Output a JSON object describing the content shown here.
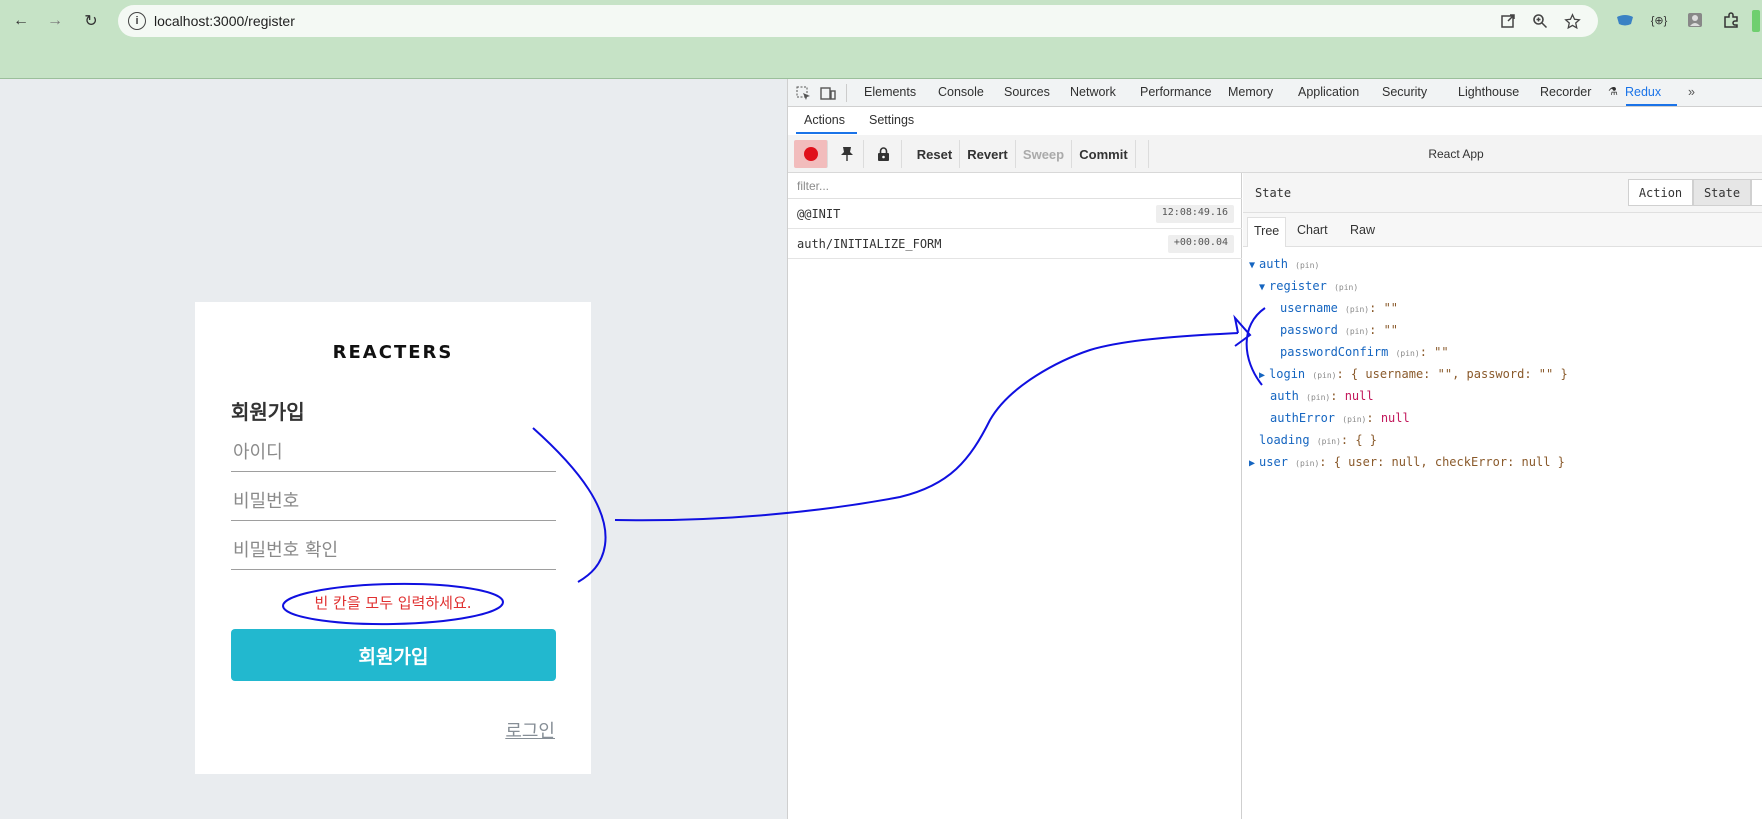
{
  "browser": {
    "url": "localhost:3000/register",
    "back_glyph": "←",
    "forward_glyph": "→",
    "reload_glyph": "↻"
  },
  "app": {
    "logo": "REACTERS",
    "form_title": "회원가입",
    "username_placeholder": "아이디",
    "password_placeholder": "비밀번호",
    "password_confirm_placeholder": "비밀번호 확인",
    "error_message": "빈 칸을 모두 입력하세요.",
    "submit_label": "회원가입",
    "login_link": "로그인",
    "accent_color": "#22b8cf",
    "error_color": "#e03131"
  },
  "devtools": {
    "tabs": [
      "Elements",
      "Console",
      "Sources",
      "Network",
      "Performance",
      "Memory",
      "Application",
      "Security",
      "Lighthouse",
      "Recorder",
      "Redux"
    ],
    "active_tab": "Redux",
    "sub_tabs": [
      "Actions",
      "Settings"
    ],
    "toolbar": {
      "reset": "Reset",
      "revert": "Revert",
      "sweep": "Sweep",
      "commit": "Commit",
      "instance": "React App"
    },
    "filter_placeholder": "filter...",
    "actions": [
      {
        "name": "@@INIT",
        "time": "12:08:49.16"
      },
      {
        "name": "auth/INITIALIZE_FORM",
        "time": "+00:00.04"
      }
    ],
    "state_title": "State",
    "seg_action": "Action",
    "seg_state": "State",
    "tree_tabs": [
      "Tree",
      "Chart",
      "Raw"
    ],
    "pin": "(pin)",
    "tree": {
      "auth": "auth",
      "register": "register",
      "username": "username",
      "username_val": ": \"\"",
      "password": "password",
      "password_val": ": \"\"",
      "passwordConfirm": "passwordConfirm",
      "passwordConfirm_val": ": \"\"",
      "login": "login",
      "login_val": ": { username: \"\", password: \"\" }",
      "auth_key": "auth",
      "auth_val": "null",
      "authError": "authError",
      "authError_val": "null",
      "loading": "loading",
      "loading_val": ": { }",
      "user": "user",
      "user_val": ": { user: null, checkError: null }"
    }
  }
}
